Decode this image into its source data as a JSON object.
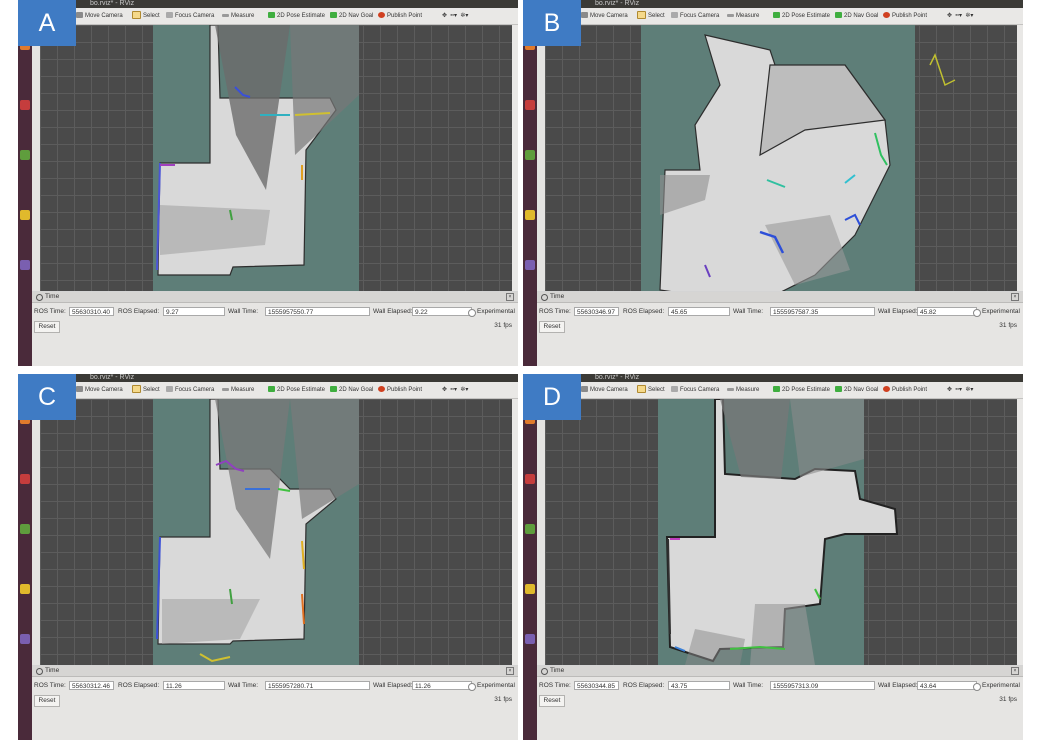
{
  "toolbar_labels": {
    "move_camera": "Move Camera",
    "select": "Select",
    "focus_camera": "Focus Camera",
    "measure": "Measure",
    "pose_estimate": "2D Pose Estimate",
    "nav_goal": "2D Nav Goal",
    "publish_point": "Publish Point"
  },
  "window_title": "bo.rviz* - RViz",
  "time_panel": {
    "title": "Time",
    "ros_time_label": "ROS Time:",
    "ros_elapsed_label": "ROS Elapsed:",
    "wall_time_label": "Wall Time:",
    "wall_elapsed_label": "Wall Elapsed:",
    "experimental_label": "Experimental",
    "reset_label": "Reset"
  },
  "panels": [
    {
      "letter": "A",
      "ros_time": "55630310.40",
      "ros_elapsed": "9.27",
      "wall_time": "1555957550.77",
      "wall_elapsed": "9.22",
      "fps": "31 fps"
    },
    {
      "letter": "B",
      "ros_time": "55630346.97",
      "ros_elapsed": "45.65",
      "wall_time": "1555957587.35",
      "wall_elapsed": "45.82",
      "fps": "31 fps"
    },
    {
      "letter": "C",
      "ros_time": "55630312.46",
      "ros_elapsed": "11.26",
      "wall_time": "1555957280.71",
      "wall_elapsed": "11.26",
      "fps": "31 fps"
    },
    {
      "letter": "D",
      "ros_time": "55630344.85",
      "ros_elapsed": "43.75",
      "wall_time": "1555957313.09",
      "wall_elapsed": "43.64",
      "fps": "31 fps"
    }
  ],
  "colors": {
    "label_bg": "#3f7bc4",
    "grid_bg": "#4a4a4a",
    "costmap": "#5e7e78",
    "free_space": "#d9d9d9",
    "wall": "#222222"
  }
}
